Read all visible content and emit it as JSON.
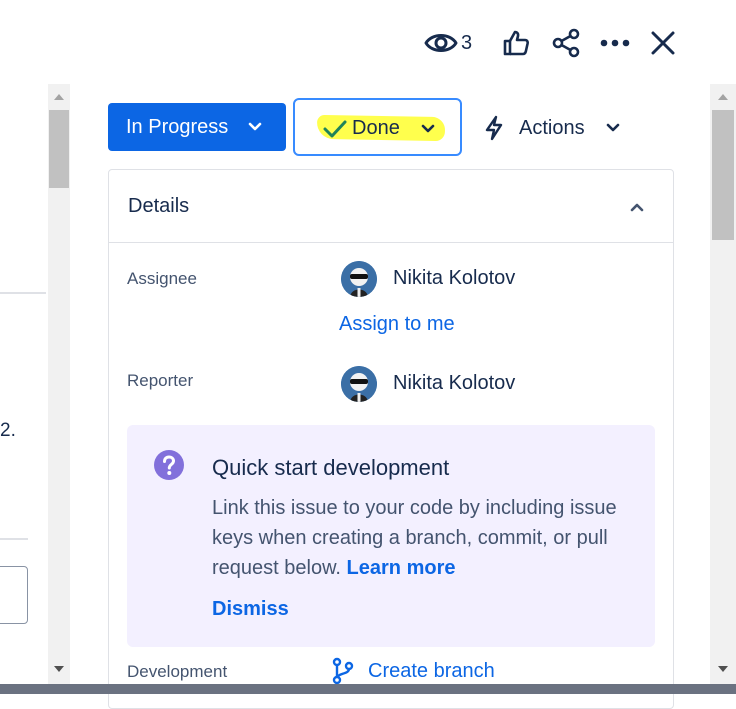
{
  "toolbar": {
    "watch_count": "3",
    "icons": [
      "eye-icon",
      "thumbs-up-icon",
      "share-icon",
      "more-icon",
      "close-icon"
    ]
  },
  "left_fragment": {
    "text": "2."
  },
  "status": {
    "current_label": "In Progress",
    "transition_label": "Done",
    "actions_label": "Actions"
  },
  "details": {
    "title": "Details",
    "assignee_label": "Assignee",
    "assignee_name": "Nikita Kolotov",
    "assign_to_me": "Assign to me",
    "reporter_label": "Reporter",
    "reporter_name": "Nikita Kolotov",
    "development_label": "Development",
    "create_branch": "Create branch"
  },
  "quick_start": {
    "title": "Quick start development",
    "body": "Link this issue to your code by including issue keys when creating a branch, commit, or pull request below.",
    "learn_more": "Learn more",
    "dismiss": "Dismiss"
  },
  "colors": {
    "primary": "#0c66e4",
    "focus_border": "#388bff",
    "highlight": "#ffff4d",
    "check": "#1f845a",
    "card_bg": "#f3f0ff",
    "question_icon": "#8270db"
  }
}
